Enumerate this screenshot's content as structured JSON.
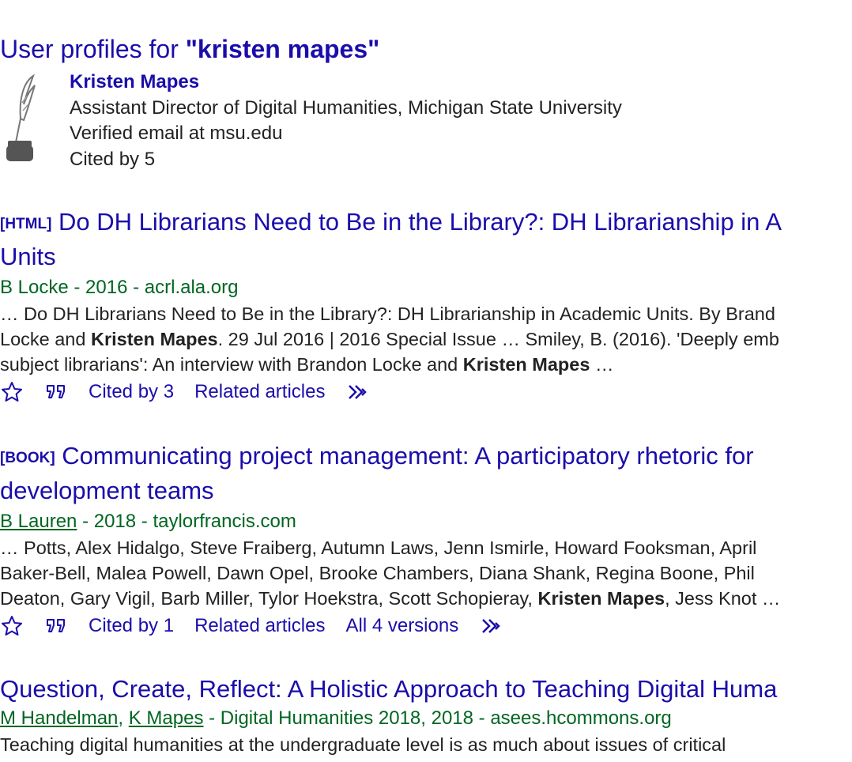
{
  "profiles": {
    "heading_prefix": "User profiles for ",
    "heading_query": "\"kristen mapes\"",
    "user": {
      "name": "Kristen Mapes",
      "affiliation": "Assistant Director of Digital Humanities, Michigan State University",
      "email": "Verified email at msu.edu",
      "cited": "Cited by 5",
      "avatar_icon": "quill-ink-icon"
    }
  },
  "results": [
    {
      "tag": "[HTML]",
      "title_line1": "Do DH Librarians Need to Be in the Library?: DH Librarianship in A",
      "title_line2": "Units",
      "authors": "B Locke",
      "rest_meta": " - 2016 - acrl.ala.org",
      "snippet": [
        [
          "… Do DH Librarians Need to Be in the Library?: DH Librarianship in Academic Units. By Brand"
        ],
        [
          "Locke and ",
          "Kristen Mapes",
          ". 29 Jul 2016 | 2016 Special Issue … Smiley, B. (2016). 'Deeply emb"
        ],
        [
          "subject librarians': An interview with Brandon Locke and ",
          "Kristen Mapes",
          " …"
        ]
      ],
      "cited": "Cited by 3",
      "related": "Related articles",
      "versions": ""
    },
    {
      "tag": "[BOOK]",
      "title_line1": "Communicating project management: A participatory rhetoric for",
      "title_line2": "development teams",
      "authors": "B Lauren",
      "rest_meta": " - 2018 - taylorfrancis.com",
      "snippet": [
        [
          "… Potts, Alex Hidalgo, Steve Fraiberg, Autumn Laws, Jenn Ismirle, Howard Fooksman, April"
        ],
        [
          "Baker-Bell, Malea Powell, Dawn Opel, Brooke Chambers, Diana Shank, Regina Boone, Phil"
        ],
        [
          "Deaton, Gary Vigil, Barb Miller, Tylor Hoekstra, Scott Schopieray, ",
          "Kristen Mapes",
          ", Jess Knot …"
        ]
      ],
      "cited": "Cited by 1",
      "related": "Related articles",
      "versions": "All 4 versions"
    },
    {
      "title_line1": "Question, Create, Reflect: A Holistic Approach to Teaching Digital Huma",
      "author1": "M Handelman",
      "author2": "K Mapes",
      "rest_meta": " - Digital Humanities 2018, 2018 - asees.hcommons.org",
      "snippet_line1": "Teaching digital humanities at the undergraduate level is as much about issues of critical"
    }
  ],
  "icons": {
    "save": "star-icon",
    "cite": "quote-icon",
    "more": "double-chevron-icon"
  },
  "colors": {
    "link": "#1a0dab",
    "meta": "#006621",
    "text": "#222222"
  }
}
